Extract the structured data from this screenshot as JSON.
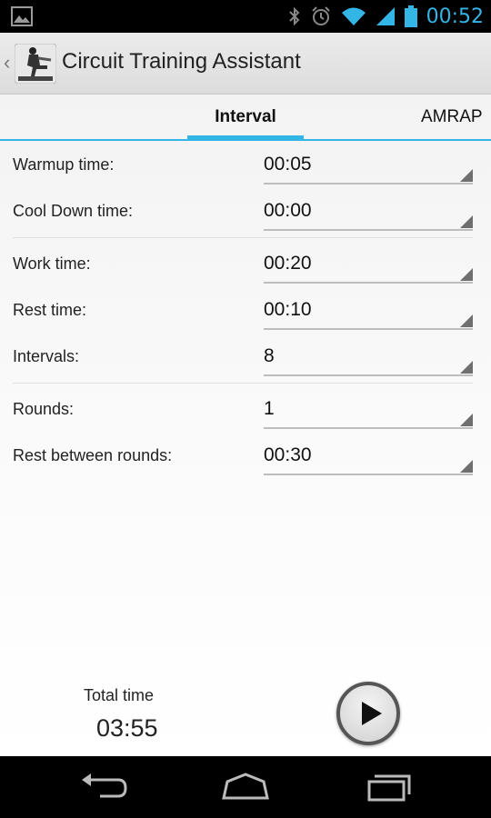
{
  "status_bar": {
    "time": "00:52",
    "icons": [
      "gallery-icon",
      "bluetooth-icon",
      "alarm-icon",
      "wifi-icon",
      "signal-icon",
      "battery-icon"
    ]
  },
  "action_bar": {
    "title": "Circuit Training Assistant",
    "icon": "app-icon"
  },
  "tabs": [
    {
      "label": "Interval",
      "selected": true
    },
    {
      "label": "AMRAP",
      "selected": false
    }
  ],
  "settings": [
    {
      "label": "Warmup time:",
      "value": "00:05"
    },
    {
      "label": "Cool Down time:",
      "value": "00:00"
    },
    {
      "label": "Work time:",
      "value": "00:20"
    },
    {
      "label": "Rest time:",
      "value": "00:10"
    },
    {
      "label": "Intervals:",
      "value": "8"
    },
    {
      "label": "Rounds:",
      "value": "1"
    },
    {
      "label": "Rest between rounds:",
      "value": "00:30"
    }
  ],
  "total": {
    "label": "Total time",
    "value": "03:55"
  },
  "colors": {
    "accent": "#33b5e5"
  },
  "nav_bar": {
    "icons": [
      "back-icon",
      "home-icon",
      "recent-apps-icon"
    ]
  }
}
